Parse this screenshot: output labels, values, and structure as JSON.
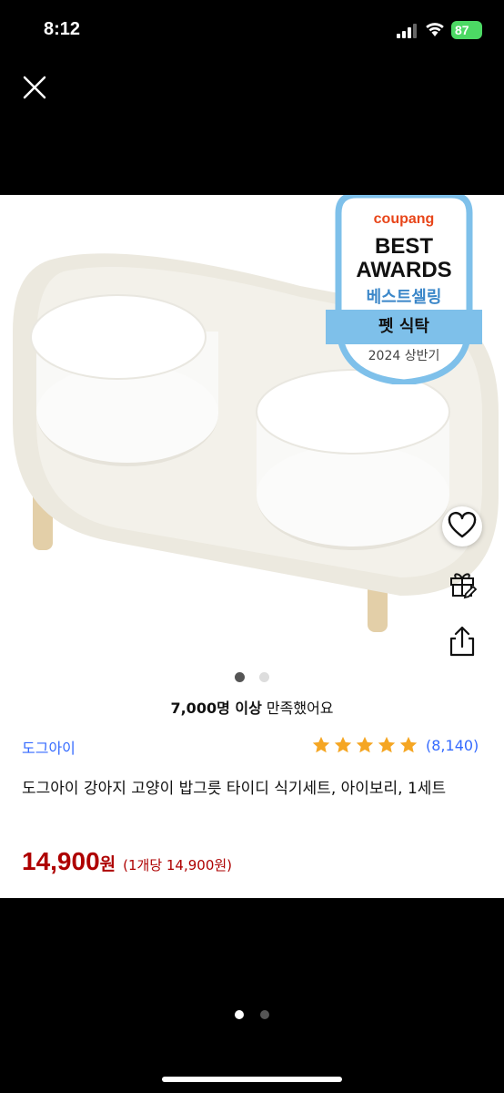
{
  "status_bar": {
    "time": "8:12",
    "battery": "87"
  },
  "icons": {
    "close": "close-icon",
    "heart": "heart-icon",
    "gift": "gift-icon",
    "share": "share-icon",
    "star": "star-icon"
  },
  "badge": {
    "brand": "coupang",
    "line1": "BEST",
    "line2": "AWARDS",
    "line3": "베스트셀링",
    "category": "펫 식탁",
    "period": "2024 상반기"
  },
  "carousel": {
    "total": 2,
    "active": 1
  },
  "satisfaction": {
    "count": "7,000명 이상",
    "text": "만족했어요"
  },
  "product": {
    "brand": "도그아이",
    "rating_stars": 5,
    "review_count": "(8,140)",
    "title": "도그아이 강아지 고양이 밥그릇 타이디 식기세트, 아이보리, 1세트",
    "price": "14,900",
    "currency": "원",
    "unit_price": "(1개당 14,900원)"
  },
  "pager": {
    "total": 2,
    "active": 1
  },
  "colors": {
    "price": "#ae0000",
    "link": "#346aff",
    "star": "#f5a623",
    "battery": "#4cd964"
  }
}
